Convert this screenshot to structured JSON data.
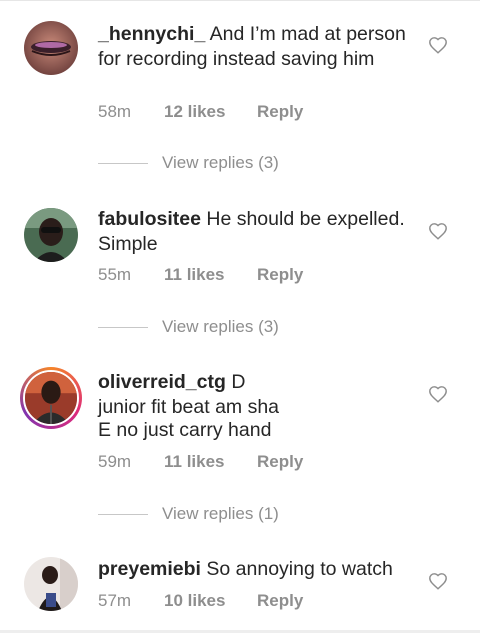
{
  "comments": [
    {
      "username": "_hennychi_",
      "text": "And I’m mad at person for recording instead saving him",
      "time": "58m",
      "likes": "12 likes",
      "reply_label": "Reply",
      "view_replies": "View replies (3)",
      "avatar_icon": "avatar-photo",
      "heart_icon": "heart-outline-icon"
    },
    {
      "username": "fabulositee",
      "text": "He should be expelled. Simple",
      "time": "55m",
      "likes": "11 likes",
      "reply_label": "Reply",
      "view_replies": "View replies (3)",
      "avatar_icon": "avatar-photo",
      "heart_icon": "heart-outline-icon"
    },
    {
      "username": "oliverreid_ctg",
      "text_line1": "D junior fit beat am sha",
      "text_line2": "E no just carry hand",
      "time": "59m",
      "likes": "11 likes",
      "reply_label": "Reply",
      "view_replies": "View replies (1)",
      "avatar_icon": "avatar-photo-story-ring",
      "heart_icon": "heart-outline-icon"
    },
    {
      "username": "preyemiebi",
      "text": "So annoying to watch",
      "time": "57m",
      "likes": "10 likes",
      "reply_label": "Reply",
      "avatar_icon": "avatar-photo",
      "heart_icon": "heart-outline-icon"
    }
  ],
  "colors": {
    "text": "#262626",
    "muted": "#8e8e8e",
    "story_ring": [
      "#f58529",
      "#dd2a7b",
      "#8134af"
    ]
  }
}
